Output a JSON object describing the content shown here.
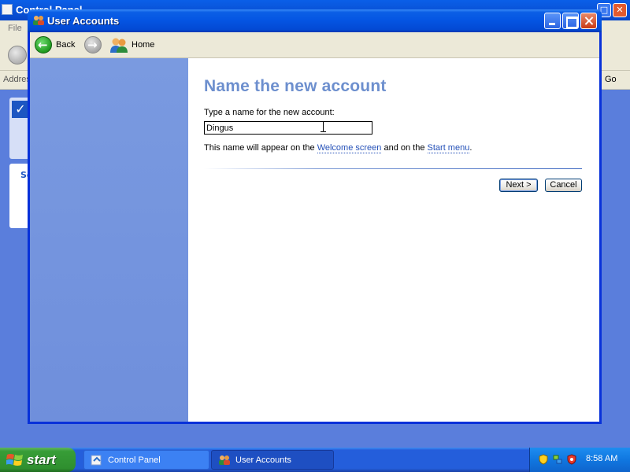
{
  "background_window": {
    "title": "Control Panel",
    "menu_file": "File",
    "address_label": "Address",
    "go_label": "Go",
    "see_also_prefix": "Se"
  },
  "window": {
    "title": "User Accounts"
  },
  "toolbar": {
    "back_label": "Back",
    "home_label": "Home"
  },
  "content": {
    "heading": "Name the new account",
    "field_label": "Type a name for the new account:",
    "name_value": "Dingus",
    "hint_prefix": "This name will appear on the ",
    "hint_link_welcome": "Welcome screen",
    "hint_middle": " and on the ",
    "hint_link_start": "Start menu",
    "hint_suffix": ".",
    "next_label": "Next >",
    "cancel_label": "Cancel"
  },
  "taskbar": {
    "start_label": "start",
    "tasks": [
      {
        "label": "Control Panel"
      },
      {
        "label": "User Accounts"
      }
    ],
    "clock": "8:58 AM"
  },
  "icons": {
    "title_icon": "user-accounts-icon",
    "back": "back-arrow-icon",
    "forward": "forward-arrow-icon",
    "home": "home-users-icon",
    "ibeam": "text-cursor-icon",
    "tray": [
      "security-shield-icon",
      "network-icon",
      "antivirus-icon"
    ]
  },
  "colors": {
    "heading": "#6d8fce",
    "link": "#2450b8",
    "left_pane": "#7a9ae0",
    "title_bar": "#0454e2",
    "start_button": "#379d37"
  }
}
